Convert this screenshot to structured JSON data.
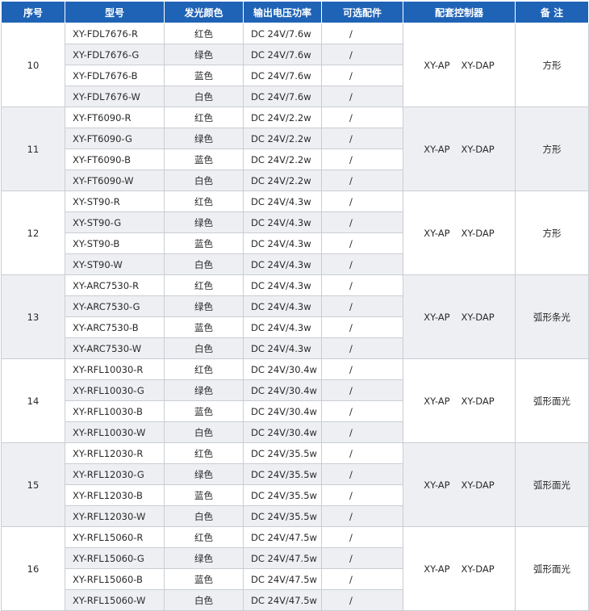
{
  "headers": [
    "序号",
    "型号",
    "发光颜色",
    "输出电压功率",
    "可选配件",
    "配套控制器",
    "备 注"
  ],
  "groups": [
    {
      "no": "10",
      "controller": [
        "XY-AP",
        "XY-DAP"
      ],
      "note": "方形",
      "rows": [
        {
          "model": "XY-FDL7676-R",
          "color": "红色",
          "power": "DC 24V/7.6w",
          "option": "/"
        },
        {
          "model": "XY-FDL7676-G",
          "color": "绿色",
          "power": "DC 24V/7.6w",
          "option": "/"
        },
        {
          "model": "XY-FDL7676-B",
          "color": "蓝色",
          "power": "DC 24V/7.6w",
          "option": "/"
        },
        {
          "model": "XY-FDL7676-W",
          "color": "白色",
          "power": "DC 24V/7.6w",
          "option": "/"
        }
      ]
    },
    {
      "no": "11",
      "controller": [
        "XY-AP",
        "XY-DAP"
      ],
      "note": "方形",
      "rows": [
        {
          "model": "XY-FT6090-R",
          "color": "红色",
          "power": "DC 24V/2.2w",
          "option": "/"
        },
        {
          "model": "XY-FT6090-G",
          "color": "绿色",
          "power": "DC 24V/2.2w",
          "option": "/"
        },
        {
          "model": "XY-FT6090-B",
          "color": "蓝色",
          "power": "DC 24V/2.2w",
          "option": "/"
        },
        {
          "model": "XY-FT6090-W",
          "color": "白色",
          "power": "DC 24V/2.2w",
          "option": "/"
        }
      ]
    },
    {
      "no": "12",
      "controller": [
        "XY-AP",
        "XY-DAP"
      ],
      "note": "方形",
      "rows": [
        {
          "model": "XY-ST90-R",
          "color": "红色",
          "power": "DC 24V/4.3w",
          "option": "/"
        },
        {
          "model": "XY-ST90-G",
          "color": "绿色",
          "power": "DC 24V/4.3w",
          "option": "/"
        },
        {
          "model": "XY-ST90-B",
          "color": "蓝色",
          "power": "DC 24V/4.3w",
          "option": "/"
        },
        {
          "model": "XY-ST90-W",
          "color": "白色",
          "power": "DC 24V/4.3w",
          "option": "/"
        }
      ]
    },
    {
      "no": "13",
      "controller": [
        "XY-AP",
        "XY-DAP"
      ],
      "note": "弧形条光",
      "rows": [
        {
          "model": "XY-ARC7530-R",
          "color": "红色",
          "power": "DC 24V/4.3w",
          "option": "/"
        },
        {
          "model": "XY-ARC7530-G",
          "color": "绿色",
          "power": "DC 24V/4.3w",
          "option": "/"
        },
        {
          "model": "XY-ARC7530-B",
          "color": "蓝色",
          "power": "DC 24V/4.3w",
          "option": "/"
        },
        {
          "model": "XY-ARC7530-W",
          "color": "白色",
          "power": "DC 24V/4.3w",
          "option": "/"
        }
      ]
    },
    {
      "no": "14",
      "controller": [
        "XY-AP",
        "XY-DAP"
      ],
      "note": "弧形面光",
      "rows": [
        {
          "model": "XY-RFL10030-R",
          "color": "红色",
          "power": "DC 24V/30.4w",
          "option": "/"
        },
        {
          "model": "XY-RFL10030-G",
          "color": "绿色",
          "power": "DC 24V/30.4w",
          "option": "/"
        },
        {
          "model": "XY-RFL10030-B",
          "color": "蓝色",
          "power": "DC 24V/30.4w",
          "option": "/"
        },
        {
          "model": "XY-RFL10030-W",
          "color": "白色",
          "power": "DC 24V/30.4w",
          "option": "/"
        }
      ]
    },
    {
      "no": "15",
      "controller": [
        "XY-AP",
        "XY-DAP"
      ],
      "note": "弧形面光",
      "rows": [
        {
          "model": "XY-RFL12030-R",
          "color": "红色",
          "power": "DC 24V/35.5w",
          "option": "/"
        },
        {
          "model": "XY-RFL12030-G",
          "color": "绿色",
          "power": "DC 24V/35.5w",
          "option": "/"
        },
        {
          "model": "XY-RFL12030-B",
          "color": "蓝色",
          "power": "DC 24V/35.5w",
          "option": "/"
        },
        {
          "model": "XY-RFL12030-W",
          "color": "白色",
          "power": "DC 24V/35.5w",
          "option": "/"
        }
      ]
    },
    {
      "no": "16",
      "controller": [
        "XY-AP",
        "XY-DAP"
      ],
      "note": "弧形面光",
      "rows": [
        {
          "model": "XY-RFL15060-R",
          "color": "红色",
          "power": "DC 24V/47.5w",
          "option": "/"
        },
        {
          "model": "XY-RFL15060-G",
          "color": "绿色",
          "power": "DC 24V/47.5w",
          "option": "/"
        },
        {
          "model": "XY-RFL15060-B",
          "color": "蓝色",
          "power": "DC 24V/47.5w",
          "option": "/"
        },
        {
          "model": "XY-RFL15060-W",
          "color": "白色",
          "power": "DC 24V/47.5w",
          "option": "/"
        }
      ]
    }
  ]
}
